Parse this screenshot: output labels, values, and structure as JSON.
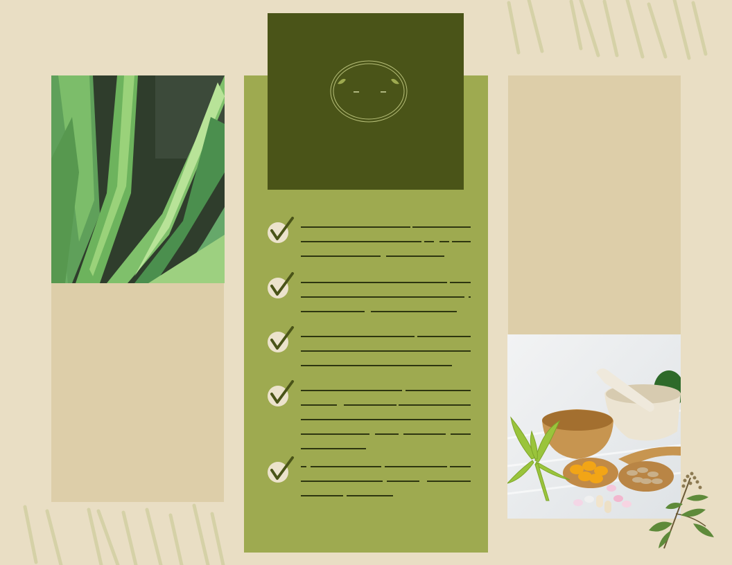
{
  "colors": {
    "background": "#e9dec4",
    "tan_panel": "#ddcea9",
    "olive_panel": "#9eaa50",
    "dark_olive": "#4a5418",
    "check_circle": "#ece3cc"
  },
  "images": {
    "left_photo": "aloe-vera-leaves",
    "right_photo": "herbal-supplements-mortar-pestle",
    "corner_sprig": "green-herb-sprig"
  },
  "logo": {
    "icon": "leaf-emblem-icon"
  },
  "checklist": [
    {
      "icon": "checkmark-icon"
    },
    {
      "icon": "checkmark-icon"
    },
    {
      "icon": "checkmark-icon"
    },
    {
      "icon": "checkmark-icon"
    },
    {
      "icon": "checkmark-icon"
    }
  ]
}
